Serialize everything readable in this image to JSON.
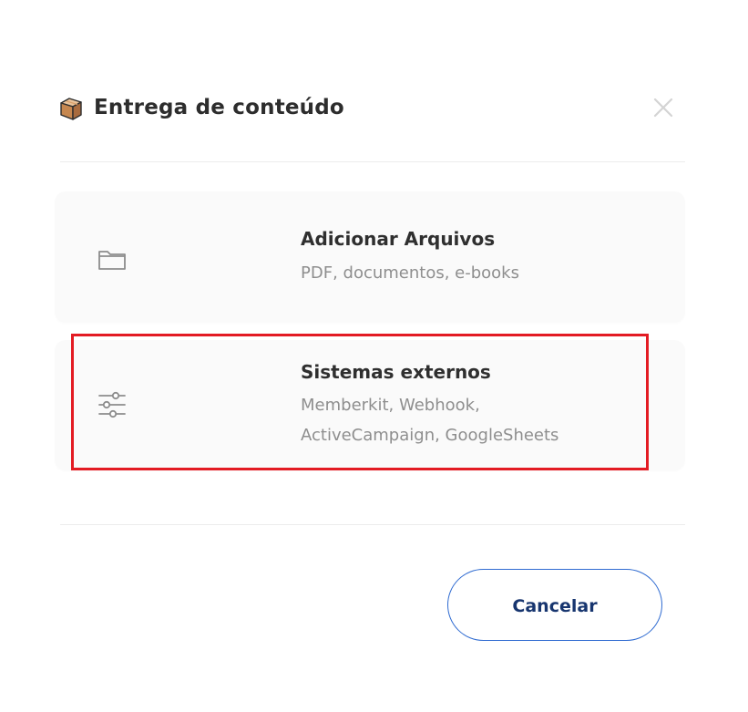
{
  "dialog": {
    "title": "Entrega de conteúdo",
    "header_icon": "package-icon",
    "close_icon": "close-icon"
  },
  "options": [
    {
      "title": "Adicionar Arquivos",
      "description_lines": [
        "PDF, documentos, e-books"
      ],
      "icon": "folder-icon"
    },
    {
      "title": "Sistemas externos",
      "description_lines": [
        "Memberkit, Webhook,",
        "ActiveCampaign, GoogleSheets"
      ],
      "icon": "sliders-icon",
      "selected": true
    }
  ],
  "footer": {
    "cancel_label": "Cancelar"
  },
  "colors": {
    "highlight": "#e31b23",
    "button_border": "#2f6bd1",
    "button_text": "#17356f"
  }
}
